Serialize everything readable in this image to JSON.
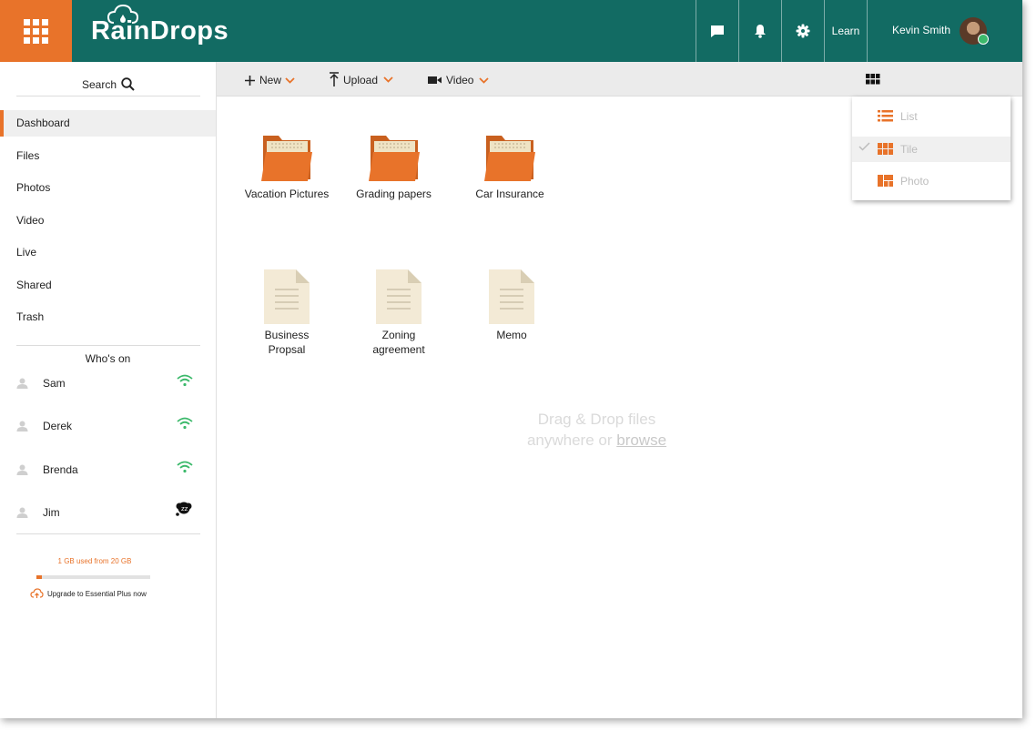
{
  "header": {
    "app_name": "RainDrops",
    "learn_label": "Learn",
    "user_name": "Kevin Smith"
  },
  "sidebar": {
    "search_label": "Search",
    "nav": [
      "Dashboard",
      "Files",
      "Photos",
      "Video",
      "Live",
      "Shared",
      "Trash"
    ],
    "active_nav": "Dashboard",
    "whos_on_title": "Who's on",
    "people": [
      {
        "name": "Sam",
        "status": "online-wifi-icon"
      },
      {
        "name": "Derek",
        "status": "online-wifi-icon"
      },
      {
        "name": "Brenda",
        "status": "online-wifi-icon"
      },
      {
        "name": "Jim",
        "status": "sleeping-icon"
      }
    ],
    "storage_text": "1 GB used from 20 GB",
    "storage_fraction": 0.05,
    "upgrade_label": "Upgrade to Essential Plus now"
  },
  "toolbar": {
    "new_label": "New",
    "upload_label": "Upload",
    "video_label": "Video"
  },
  "folders": [
    "Vacation Pictures",
    "Grading papers",
    "Car Insurance"
  ],
  "documents": [
    {
      "line1": "Business",
      "line2": "Propsal"
    },
    {
      "line1": "Zoning",
      "line2": "agreement"
    },
    {
      "line1": "Memo",
      "line2": ""
    }
  ],
  "drop_zone": {
    "line1": "Drag & Drop files",
    "line2_prefix": "anywhere or ",
    "browse_label": "browse"
  },
  "view_menu": {
    "options": [
      "List",
      "Tile",
      "Photo"
    ],
    "selected": "Tile"
  },
  "colors": {
    "header_bg": "#126b63",
    "accent": "#e8732a",
    "online": "#3cb96b"
  }
}
